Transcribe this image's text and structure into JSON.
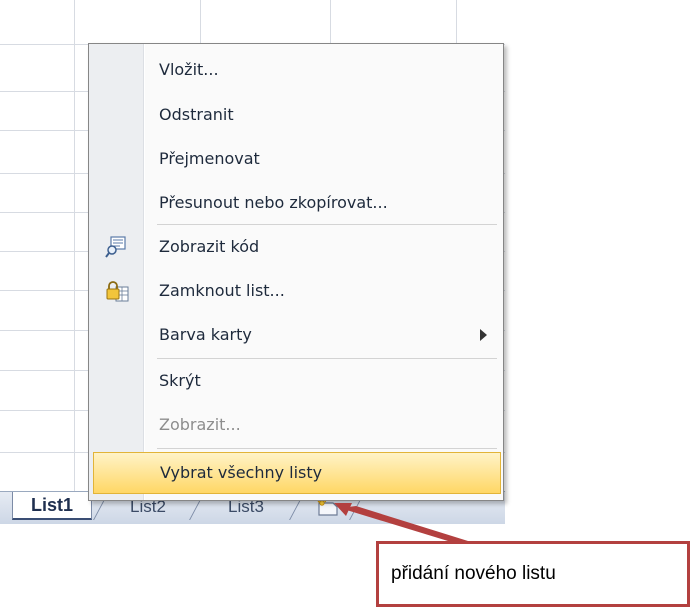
{
  "context_menu": {
    "items": [
      {
        "label": "Vložit...",
        "icon": "",
        "state": "normal"
      },
      {
        "label": "Odstranit",
        "icon": "",
        "state": "normal"
      },
      {
        "label": "Přejmenovat",
        "icon": "",
        "state": "normal"
      },
      {
        "label": "Přesunout nebo zkopírovat...",
        "icon": "",
        "state": "normal"
      },
      {
        "label": "Zobrazit kód",
        "icon": "view-code-icon",
        "state": "normal"
      },
      {
        "label": "Zamknout list...",
        "icon": "lock-sheet-icon",
        "state": "normal"
      },
      {
        "label": "Barva karty",
        "icon": "",
        "state": "submenu"
      },
      {
        "label": "Skrýt",
        "icon": "",
        "state": "normal"
      },
      {
        "label": "Zobrazit...",
        "icon": "",
        "state": "disabled"
      },
      {
        "label": "Vybrat všechny listy",
        "icon": "",
        "state": "highlighted"
      }
    ]
  },
  "sheet_tabs": {
    "tabs": [
      "List1",
      "List2",
      "List3"
    ],
    "active": "List1",
    "new_sheet_icon": "insert-sheet-icon"
  },
  "callout": {
    "text": "přidání nového listu",
    "color": "#b3403f"
  }
}
